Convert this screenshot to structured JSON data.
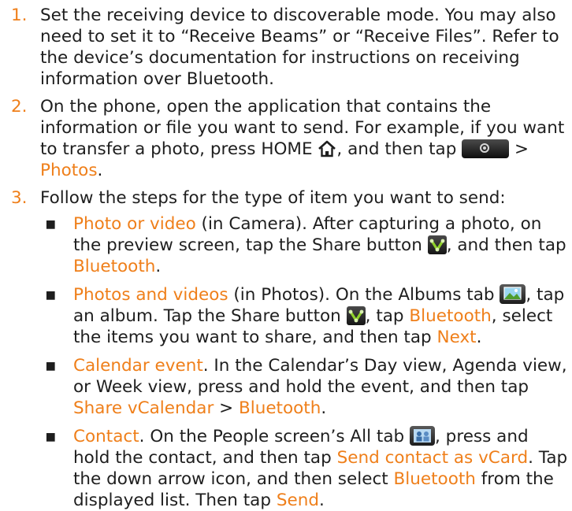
{
  "colors": {
    "accent": "#ef7f1a",
    "text": "#1e1e1e",
    "background": "#ffffff"
  },
  "steps": [
    {
      "number": "1.",
      "text": "Set the receiving device to discoverable mode. You may also need to set it to “Receive Beams” or “Receive Files”. Refer to the device’s documentation for instructions on receiving information over Bluetooth."
    },
    {
      "number": "2.",
      "text_before_home": "On the phone, open the application that contains the information or file you want to send. For example, if you want to transfer a photo, press HOME",
      "text_after_home": ", and then tap",
      "link_sep": " > ",
      "link": "Photos",
      "end": "."
    },
    {
      "number": "3.",
      "text": "Follow the steps for the type of item you want to send:"
    }
  ],
  "bullets": {
    "marker": "▪",
    "photo_video": {
      "title": "Photo or video",
      "text1": " (in Camera). After capturing a photo, on the preview screen, tap the Share button ",
      "text2": ", and then tap ",
      "link": "Bluetooth",
      "end": "."
    },
    "photos_videos": {
      "title": "Photos and videos",
      "text1": " (in Photos). On the Albums tab ",
      "text2": ", tap an album. Tap the Share button ",
      "text3": ", tap ",
      "link1": "Bluetooth",
      "text4": ", select the items you want to share, and then tap ",
      "link2": "Next",
      "end": "."
    },
    "calendar": {
      "title": "Calendar event",
      "text1": ". In the Calendar’s Day view, Agenda view, or Week view, press and hold the event, and then tap ",
      "link1": "Share vCalendar",
      "sep": " > ",
      "link2": "Bluetooth",
      "end": "."
    },
    "contact": {
      "title": "Contact",
      "text1": ". On the People screen’s All tab ",
      "text2": ", press and hold the contact, and then tap ",
      "link1": "Send contact as vCard",
      "text3": ". Tap the down arrow icon, and then select ",
      "link2": "Bluetooth",
      "text4": " from the displayed list. Then tap ",
      "link3": "Send",
      "end": "."
    }
  },
  "icons": {
    "home": "home-icon",
    "camera": "camera-icon",
    "share": "share-icon",
    "albums": "albums-tab-icon",
    "people": "people-all-tab-icon"
  }
}
